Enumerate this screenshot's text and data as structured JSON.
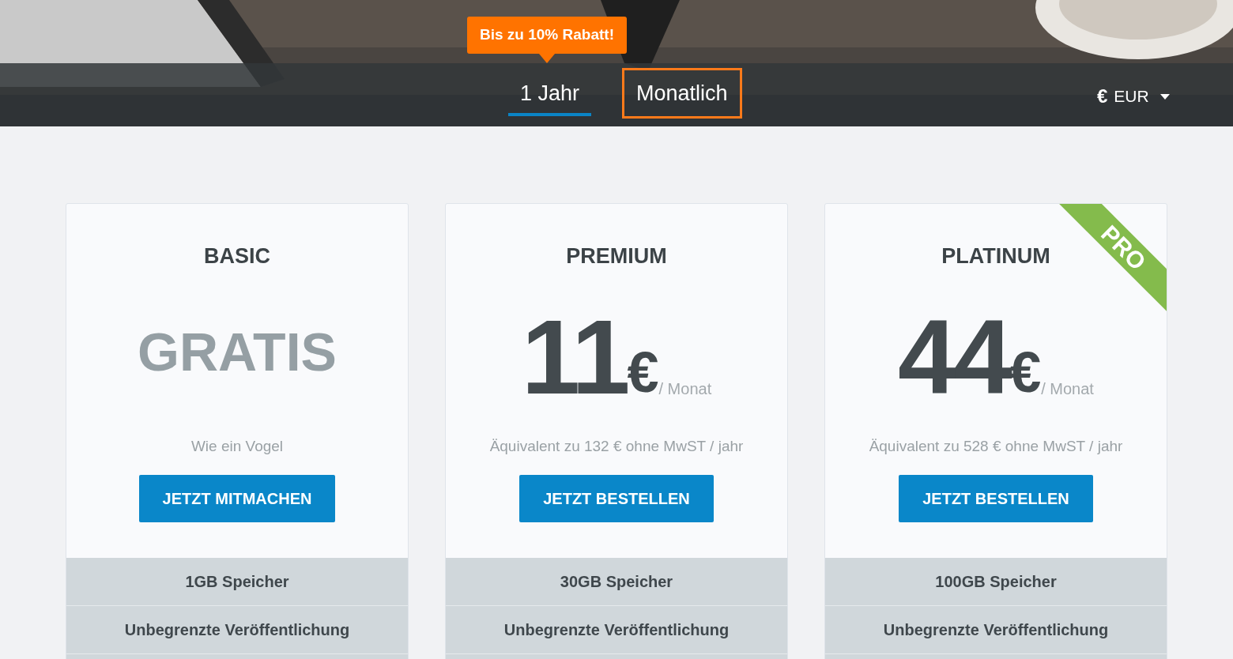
{
  "header": {
    "promo_badge": "Bis zu 10% Rabatt!",
    "billing_tabs": [
      {
        "label": "1 Jahr",
        "selected": true,
        "outlined": false
      },
      {
        "label": "Monatlich",
        "selected": false,
        "outlined": true
      }
    ],
    "currency": {
      "symbol": "€",
      "code": "EUR"
    }
  },
  "plans": [
    {
      "name": "BASIC",
      "kind": "free",
      "price": "GRATIS",
      "subtitle": "Wie ein Vogel",
      "button": "JETZT MITMACHEN",
      "features": [
        "1GB Speicher",
        "Unbegrenzte Veröffentlichung"
      ]
    },
    {
      "name": "PREMIUM",
      "kind": "paid",
      "price": "11",
      "currency": "€",
      "period": "/ Monat",
      "subtitle": "Äquivalent zu 132 € ohne MwST / jahr",
      "button": "JETZT BESTELLEN",
      "features": [
        "30GB Speicher",
        "Unbegrenzte Veröffentlichung"
      ]
    },
    {
      "name": "PLATINUM",
      "kind": "paid",
      "ribbon": "PRO",
      "price": "44",
      "currency": "€",
      "period": "/ Monat",
      "subtitle": "Äquivalent zu 528 € ohne MwST / jahr",
      "button": "JETZT BESTELLEN",
      "features": [
        "100GB Speicher",
        "Unbegrenzte Veröffentlichung"
      ]
    }
  ]
}
